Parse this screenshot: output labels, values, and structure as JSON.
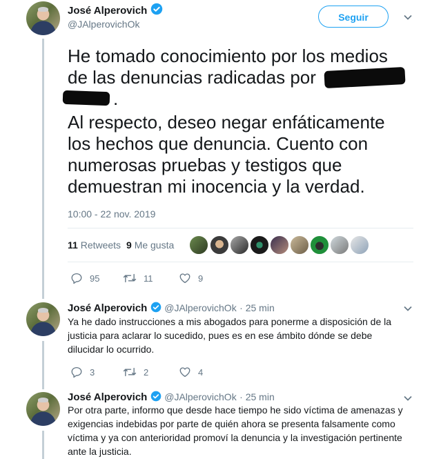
{
  "main_tweet": {
    "name": "José Alperovich",
    "handle": "@JAlperovichOk",
    "follow_label": "Seguir",
    "text_lines": [
      "He tomado conocimiento por los medios",
      "de las denuncias radicadas por",
      ".",
      "Al respecto, deseo negar enfáticamente",
      "los hechos que denuncia. Cuento con",
      "numerosas pruebas y testigos que",
      "demuestran mi inocencia y  la verdad."
    ],
    "timestamp": "10:00 - 22 nov. 2019",
    "retweets_count": "11",
    "retweets_label": "Retweets",
    "likes_count": "9",
    "likes_label": "Me gusta",
    "actions": {
      "replies": "95",
      "retweets": "11",
      "likes": "9"
    }
  },
  "replies": [
    {
      "name": "José Alperovich",
      "handle": "@JAlperovichOk",
      "time": "· 25 min",
      "text": "Ya he dado instrucciones a mis abogados para ponerme a disposición de la justicia para aclarar lo sucedido, pues es en ese ámbito dónde se debe dilucidar lo ocurrido.",
      "actions": {
        "replies": "3",
        "retweets": "2",
        "likes": "4"
      }
    },
    {
      "name": "José Alperovich",
      "handle": "@JAlperovichOk",
      "time": "· 25 min",
      "text": "Por otra parte, informo que desde hace tiempo he sido víctima de amenazas y exigencias indebidas por parte de quién ahora se presenta falsamente como víctima y ya con anterioridad promoví la denuncia y la investigación pertinente ante la justicia."
    }
  ],
  "colors": {
    "accent": "#1da1f2",
    "text": "#14171a",
    "muted": "#657786",
    "thread_line": "#c4cfd6"
  },
  "icons": [
    "verified-badge-icon",
    "chevron-down-icon",
    "reply-icon",
    "retweet-icon",
    "heart-icon"
  ]
}
